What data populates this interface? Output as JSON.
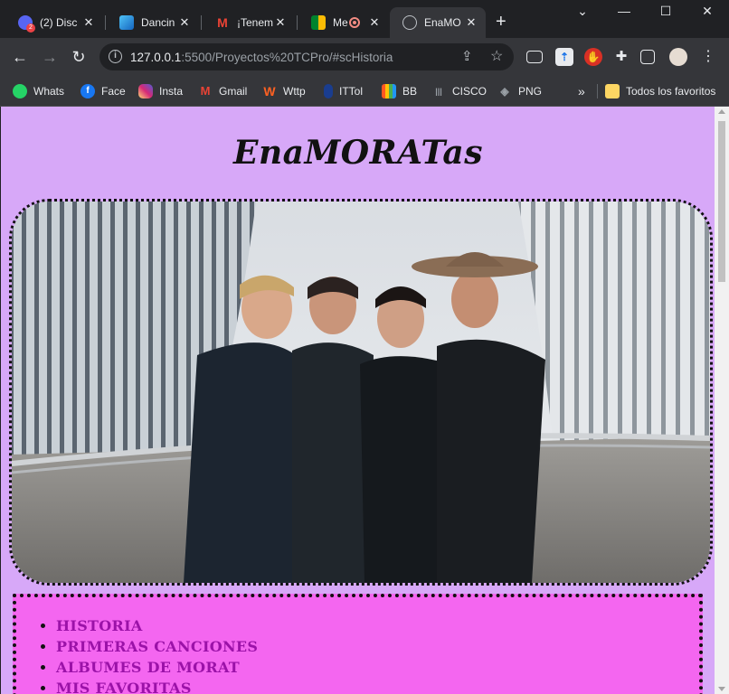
{
  "tabs": [
    {
      "title": "(2) Disc",
      "icon": "discord-icon",
      "badge": "2"
    },
    {
      "title": "Dancin",
      "icon": "dancing-icon"
    },
    {
      "title": "¡Tenem",
      "icon": "gmail-icon"
    },
    {
      "title": "Me",
      "icon": "meet-icon"
    },
    {
      "title": "EnaMO",
      "icon": "globe-icon"
    }
  ],
  "address_bar": {
    "host": "127.0.0.1",
    "path": ":5500/Proyectos%20TCPro/#scHistoria"
  },
  "bookmarks": [
    {
      "label": "Whats",
      "icon": "whatsapp-icon",
      "color": "#25d366"
    },
    {
      "label": "Face",
      "icon": "facebook-icon",
      "color": "#1877f2"
    },
    {
      "label": "Insta",
      "icon": "instagram-icon",
      "color": "#d6249f"
    },
    {
      "label": "Gmail",
      "icon": "gmail-icon",
      "color": "#ea4335"
    },
    {
      "label": "Wttp",
      "icon": "wattpad-icon",
      "color": "#ff6122"
    },
    {
      "label": "ITTol",
      "icon": "ittol-icon",
      "color": "#1a3d8f"
    },
    {
      "label": "BB",
      "icon": "bb-icon",
      "color": "#ff5722"
    },
    {
      "label": "CISCO",
      "icon": "cisco-icon",
      "color": "#9aa0a6"
    },
    {
      "label": "PNG",
      "icon": "png-icon",
      "color": "#9aa0a6"
    }
  ],
  "bookmarks_overflow": "»",
  "all_bookmarks_label": "Todos los favoritos",
  "page": {
    "title": "EnaMORATas",
    "menu": [
      "HISTORIA",
      "PRIMERAS CANCIONES",
      "ALBUMES DE MORAT",
      "MIS FAVORITAS"
    ]
  },
  "colors": {
    "page_bg": "#d7a8f8",
    "menu_bg": "#f466f0",
    "menu_text": "#9b12a8"
  }
}
